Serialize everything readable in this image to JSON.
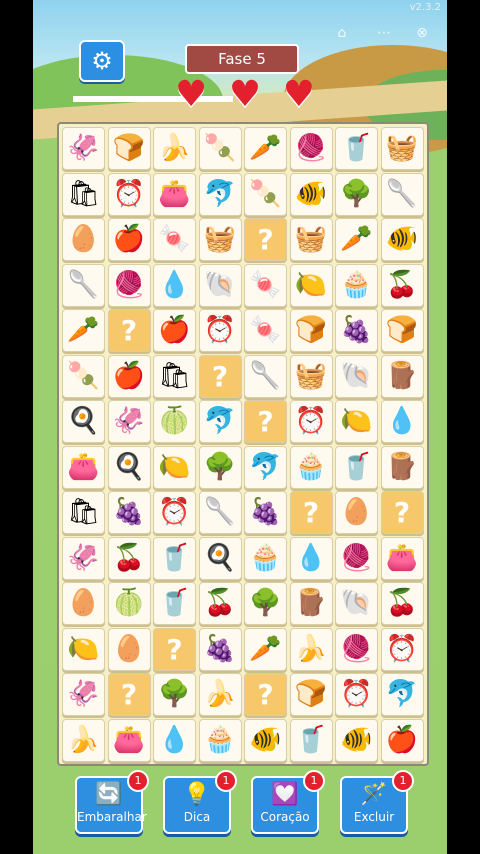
{
  "version": "v2.3.2",
  "level_label": "Fase 5",
  "lives": 3,
  "hearts": [
    "♥",
    "♥",
    "♥"
  ],
  "icons": {
    "settings": "⚙",
    "home": "⌂",
    "more": "⋯",
    "close": "⊗"
  },
  "board": {
    "rows": 14,
    "cols": 8,
    "mystery_symbol": "?",
    "tiles": [
      [
        "squid",
        "bread",
        "banana",
        "popsicle",
        "carrot",
        "yarn",
        "cup",
        "basket"
      ],
      [
        "sack",
        "clock",
        "purse",
        "dolphin",
        "popsicle",
        "fish",
        "tree",
        "spoon"
      ],
      [
        "egg",
        "apple",
        "candy",
        "basket",
        "?",
        "basket",
        "carrot",
        "fish"
      ],
      [
        "spoon",
        "yarn",
        "drop",
        "shell",
        "candy",
        "lemon",
        "cupcake",
        "cherry"
      ],
      [
        "carrot",
        "?",
        "apple",
        "clock",
        "candy",
        "bread",
        "grapes",
        "bread"
      ],
      [
        "popsicle",
        "apple",
        "sack",
        "?",
        "spoon",
        "basket",
        "shell",
        "log"
      ],
      [
        "pan",
        "squid",
        "melon",
        "dolphin",
        "?",
        "clock",
        "lemon",
        "drop"
      ],
      [
        "purse",
        "pan",
        "lemon",
        "tree",
        "dolphin",
        "cupcake",
        "cup",
        "log"
      ],
      [
        "sack",
        "grapes",
        "clock",
        "spoon",
        "grapes",
        "?",
        "egg",
        "?"
      ],
      [
        "squid",
        "cherry",
        "cup",
        "pan",
        "cupcake",
        "drop",
        "yarn",
        "purse"
      ],
      [
        "egg",
        "melon",
        "cup",
        "cherry",
        "tree",
        "log",
        "shell",
        "cherry"
      ],
      [
        "lemon",
        "egg",
        "?",
        "grapes",
        "carrot",
        "banana",
        "yarn",
        "clock"
      ],
      [
        "squid",
        "?",
        "tree",
        "banana",
        "?",
        "bread",
        "clock",
        "dolphin"
      ],
      [
        "banana",
        "purse",
        "drop",
        "cupcake",
        "fish",
        "cup",
        "fish",
        "apple"
      ]
    ]
  },
  "glyphs": {
    "squid": "🦑",
    "bread": "🍞",
    "banana": "🍌",
    "popsicle": "🍡",
    "carrot": "🥕",
    "yarn": "🧶",
    "cup": "🥤",
    "basket": "🧺",
    "sack": "🛍",
    "clock": "⏰",
    "purse": "👛",
    "dolphin": "🐬",
    "fish": "🐠",
    "tree": "🌳",
    "spoon": "🥄",
    "egg": "🥚",
    "apple": "🍎",
    "candy": "🍬",
    "drop": "💧",
    "shell": "🐚",
    "lemon": "🍋",
    "cupcake": "🧁",
    "cherry": "🍒",
    "grapes": "🍇",
    "log": "🪵",
    "pan": "🍳",
    "melon": "🍈"
  },
  "toolbar": [
    {
      "label": "Embaralhar",
      "icon": "🔄",
      "count": "1"
    },
    {
      "label": "Dica",
      "icon": "💡",
      "count": "1"
    },
    {
      "label": "Coração",
      "icon": "💟",
      "count": "1"
    },
    {
      "label": "Excluir",
      "icon": "🪄",
      "count": "1"
    }
  ],
  "colors": {
    "accent": "#2e8fe0",
    "heart": "#e3202d",
    "level_bg": "#a14a44",
    "mystery": "#f7c86b"
  }
}
